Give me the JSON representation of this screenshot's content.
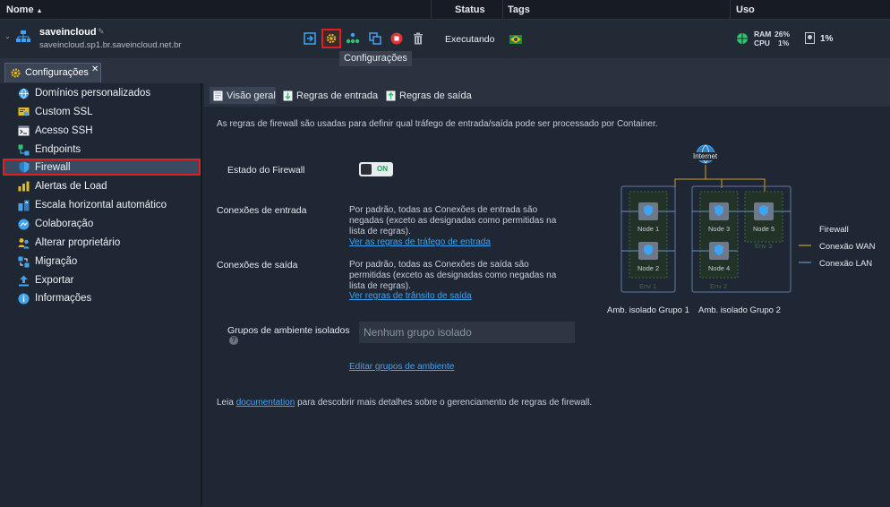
{
  "header": {
    "col_name": "Nome",
    "col_status": "Status",
    "col_tags": "Tags",
    "col_usage": "Uso"
  },
  "env": {
    "name": "saveincloud",
    "domain": "saveincloud.sp1.br.saveincloud.net.br",
    "status": "Executando",
    "ram_label": "RAM",
    "ram_value": "26%",
    "cpu_label": "CPU",
    "cpu_value": "1%",
    "disk_value": "1%"
  },
  "tooltip": "Configurações",
  "tab": {
    "label": "Configurações",
    "close": "✕"
  },
  "sidebar": {
    "items": [
      {
        "label": "Domínios personalizados",
        "icon": "globe-icon"
      },
      {
        "label": "Custom SSL",
        "icon": "certificate-icon"
      },
      {
        "label": "Acesso SSH",
        "icon": "terminal-icon"
      },
      {
        "label": "Endpoints",
        "icon": "endpoints-icon"
      },
      {
        "label": "Firewall",
        "icon": "shield-icon"
      },
      {
        "label": "Alertas de Load",
        "icon": "alert-chart-icon"
      },
      {
        "label": "Escala horizontal automático",
        "icon": "scaling-icon"
      },
      {
        "label": "Colaboração",
        "icon": "collaboration-icon"
      },
      {
        "label": "Alterar proprietário",
        "icon": "change-owner-icon"
      },
      {
        "label": "Migração",
        "icon": "migration-icon"
      },
      {
        "label": "Exportar",
        "icon": "export-icon"
      },
      {
        "label": "Informações",
        "icon": "info-icon"
      }
    ]
  },
  "subtabs": {
    "overview": "Visão geral",
    "inbound": "Regras de entrada",
    "outbound": "Regras de saída"
  },
  "content": {
    "intro": "As regras de firewall são usadas para definir qual tráfego de entrada/saída pode ser processado por Container.",
    "state_label": "Estado do Firewall",
    "state_value": "ON",
    "inbound_label": "Conexões de entrada",
    "inbound_desc_1": "Por padrão, todas as Conexões de entrada são",
    "inbound_desc_2": "negadas (exceto as designadas como permitidas na",
    "inbound_desc_3": "lista de regras).",
    "inbound_link": "Ver as regras de tráfego de entrada",
    "outbound_label": "Conexões de saída",
    "outbound_desc_1": "Por padrão, todas as Conexões de saída são",
    "outbound_desc_2": "permitidas (exceto as designadas como negadas na",
    "outbound_desc_3": "lista de regras).",
    "outbound_link": "Ver regras de trânsito de saída",
    "groups_label": "Grupos de ambiente isolados",
    "groups_placeholder": "Nenhum grupo isolado",
    "groups_link": "Editar grupos de ambiente",
    "footer_pre": "Leia ",
    "footer_link": "documentation",
    "footer_post": " para descobrir mais detalhes sobre o gerenciamento de regras de firewall."
  },
  "diagram": {
    "internet": "Internet",
    "node1": "Node 1",
    "node2": "Node 2",
    "node3": "Node 3",
    "node4": "Node 4",
    "node5": "Node 5",
    "env1": "Env 1",
    "env2": "Env 2",
    "env3": "Env 3",
    "group1": "Amb. isolado Grupo 1",
    "group2": "Amb. isolado Grupo 2",
    "legend_firewall": "Firewall",
    "legend_wan": "Conexão WAN",
    "legend_lan": "Conexão LAN"
  },
  "colors": {
    "accent": "#3ea4f0",
    "wan": "#c9a227",
    "lan": "#6a8fc4",
    "highlight": "#e02020"
  }
}
